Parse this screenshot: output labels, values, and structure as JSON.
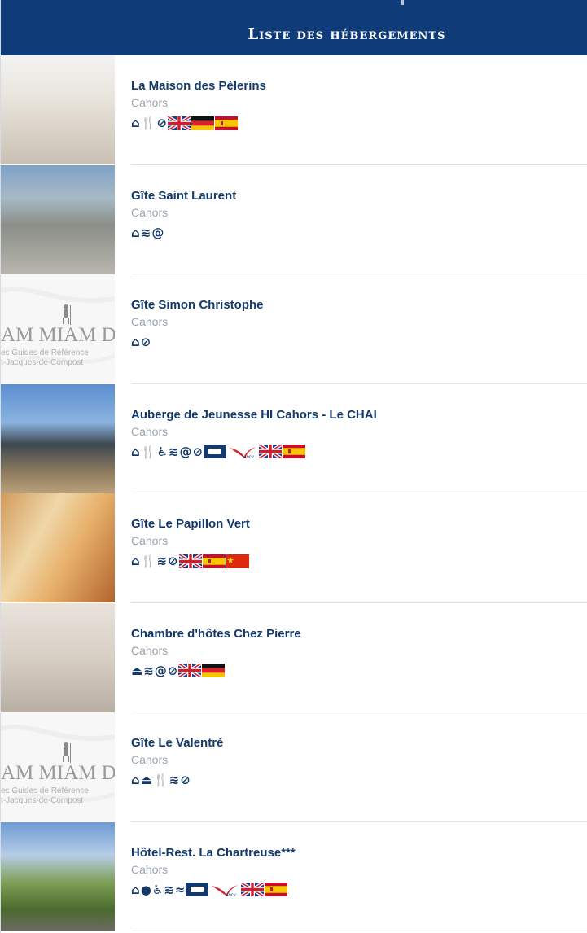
{
  "header": {
    "title": "Liste des hébergements"
  },
  "items": [
    {
      "name": "La Maison des Pèlerins",
      "city": "Cahors",
      "thumb": "photo",
      "icons": [
        "house-icon",
        "cutlery-icon",
        "no-dogs-icon",
        "flag-uk",
        "flag-de",
        "flag-es"
      ]
    },
    {
      "name": "Gîte Saint Laurent",
      "city": "Cahors",
      "thumb": "photo",
      "icons": [
        "house-icon",
        "wifi-icon",
        "at-icon"
      ]
    },
    {
      "name": "Gîte Simon Christophe",
      "city": "Cahors",
      "thumb": "logo",
      "icons": [
        "house-icon",
        "no-dogs-icon"
      ]
    },
    {
      "name": "Auberge de Jeunesse HI Cahors - Le CHAI",
      "city": "Cahors",
      "thumb": "photo",
      "icons": [
        "house-icon",
        "cutlery-icon",
        "wheelchair-icon",
        "wifi-icon",
        "at-icon",
        "no-dogs-icon",
        "card-icon",
        "ancv-icon",
        "flag-uk",
        "flag-es"
      ]
    },
    {
      "name": "Gîte Le Papillon Vert",
      "city": "Cahors",
      "thumb": "photo",
      "icons": [
        "house-icon",
        "cutlery-icon",
        "wifi-icon",
        "no-dogs-icon",
        "flag-uk",
        "flag-es",
        "flag-cn"
      ]
    },
    {
      "name": "Chambre d'hôtes Chez Pierre",
      "city": "Cahors",
      "thumb": "photo",
      "icons": [
        "bed-house-icon",
        "wifi-icon",
        "at-icon",
        "no-dogs-icon",
        "flag-uk",
        "flag-de"
      ]
    },
    {
      "name": "Gîte Le Valentré",
      "city": "Cahors",
      "thumb": "logo",
      "icons": [
        "house-icon",
        "bed-house-icon",
        "cutlery-icon",
        "wifi-icon",
        "no-dogs-icon"
      ]
    },
    {
      "name": "Hôtel-Rest. La Chartreuse***",
      "city": "Cahors",
      "thumb": "photo",
      "icons": [
        "hotel-icon",
        "restaurant-icon",
        "wheelchair-icon",
        "wifi-icon",
        "pool-icon",
        "card-icon",
        "ancv-icon",
        "flag-uk",
        "flag-es"
      ]
    }
  ],
  "logo": {
    "brand": "AM MIAM DO",
    "line1": "es Guides de Référence",
    "line2": "t-Jacques-de-Compost"
  },
  "ancv_label": "ancv",
  "colors": {
    "header_bg": "#0f3c78",
    "title_text": "#143a6c",
    "city_text": "#9aa3ad",
    "divider": "#dfe3e8"
  }
}
